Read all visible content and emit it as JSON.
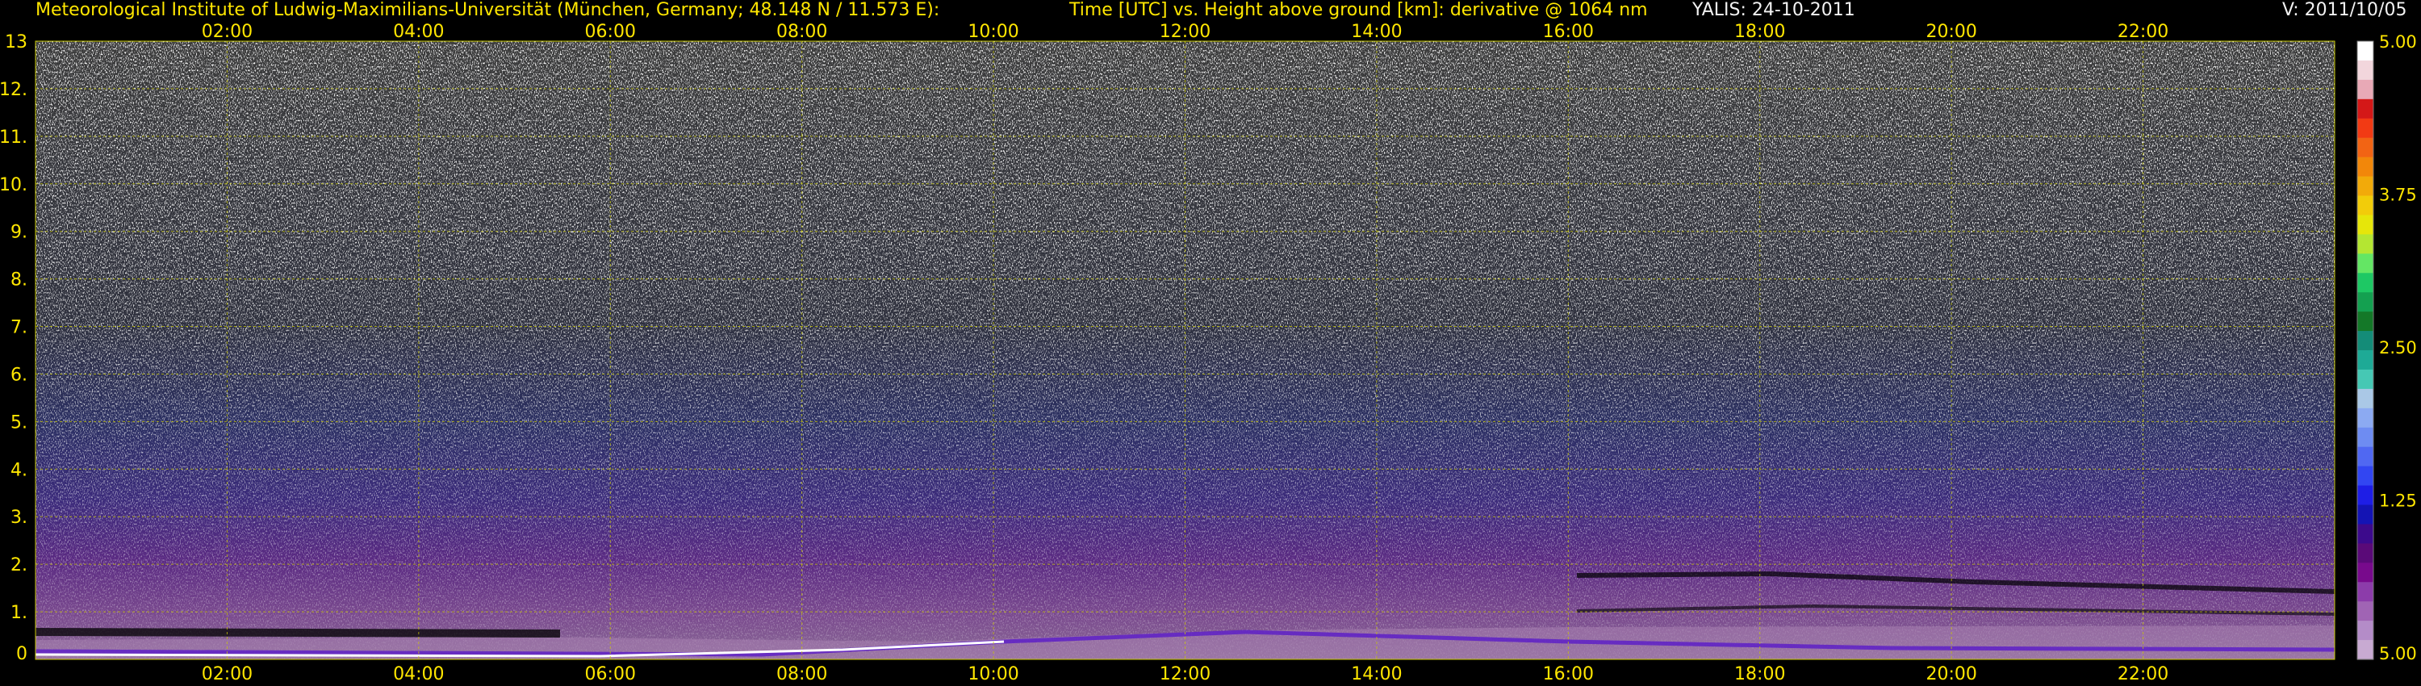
{
  "header": {
    "institute": "Meteorological Institute of Ludwig-Maximilians-Universität (München, Germany; 48.148 N / 11.573 E):",
    "title": "Time [UTC] vs. Height above ground [km]: derivative @ 1064 nm",
    "instrument": "YALIS: 24-10-2011",
    "version": "V: 2011/10/05"
  },
  "chart_data": {
    "type": "heatmap",
    "title": "Time [UTC] vs. Height above ground [km]: derivative @ 1064 nm",
    "x_axis": {
      "label": "Time [UTC]",
      "range": [
        "00:00",
        "24:00"
      ],
      "tick_labels": [
        "02:00",
        "04:00",
        "06:00",
        "08:00",
        "10:00",
        "12:00",
        "14:00",
        "16:00",
        "18:00",
        "20:00",
        "22:00"
      ]
    },
    "y_axis": {
      "label": "Height above ground [km]",
      "range": [
        0,
        13
      ],
      "tick_labels": [
        "0",
        "1.",
        "2.",
        "3.",
        "4.",
        "5.",
        "6.",
        "7.",
        "8.",
        "9.",
        "10.",
        "11.",
        "12.",
        "13"
      ]
    },
    "colorbar": {
      "tick_labels": [
        "5.00",
        "3.75",
        "2.50",
        "1.25",
        "5.00"
      ],
      "colors": [
        "#ffffff",
        "#f2d6dc",
        "#e8a9b6",
        "#d41818",
        "#f23a14",
        "#f26414",
        "#f2870a",
        "#f2aa0a",
        "#f2cc0a",
        "#e6e60a",
        "#b4e632",
        "#64e664",
        "#1ec864",
        "#14a050",
        "#147828",
        "#148c78",
        "#1eaa96",
        "#46c8b4",
        "#aac8e6",
        "#8caaf2",
        "#6e8cf2",
        "#5068f2",
        "#3246f2",
        "#1e1ee6",
        "#1414b4",
        "#3c0a8c",
        "#5a0a78",
        "#780a8c",
        "#8c3caa",
        "#a064b4",
        "#b48cc8",
        "#c8aad2"
      ]
    },
    "grid": true,
    "legend_placement": "right"
  }
}
